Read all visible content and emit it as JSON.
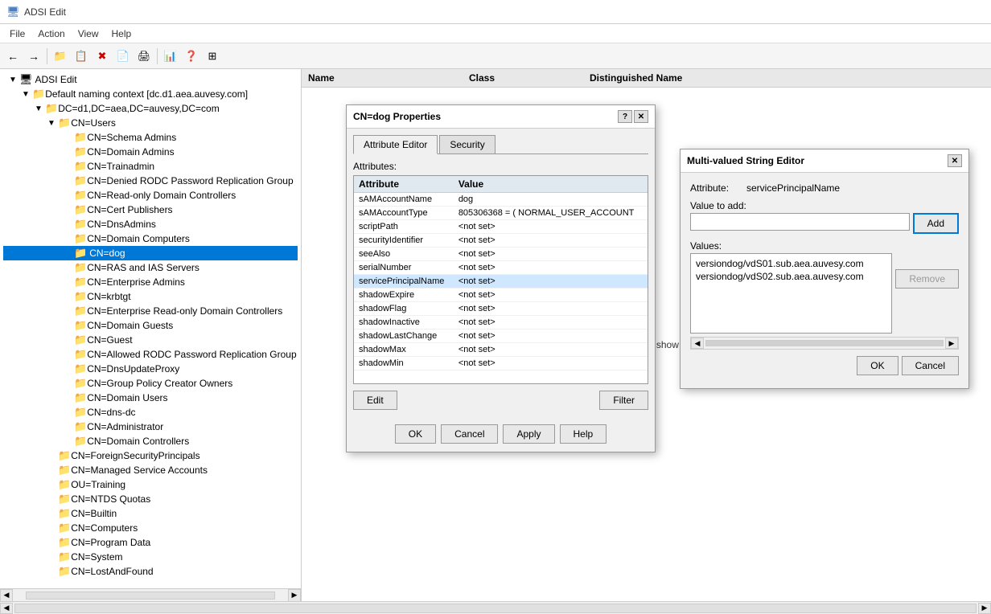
{
  "window": {
    "title": "ADSI Edit"
  },
  "menu": {
    "items": [
      "File",
      "Action",
      "View",
      "Help"
    ]
  },
  "toolbar": {
    "buttons": [
      "←",
      "→",
      "🗂",
      "📋",
      "✖",
      "📄",
      "🖨",
      "📊",
      "❓",
      "🔲"
    ]
  },
  "left_panel": {
    "header": "ADSI Edit",
    "tree": [
      {
        "label": "ADSI Edit",
        "level": 0,
        "expanded": true,
        "icon": "computer"
      },
      {
        "label": "Default naming context [dc.d1.aea.auvesy.com]",
        "level": 1,
        "expanded": true,
        "icon": "folder"
      },
      {
        "label": "DC=d1,DC=aea,DC=auvesy,DC=com",
        "level": 2,
        "expanded": true,
        "icon": "folder"
      },
      {
        "label": "CN=Users",
        "level": 3,
        "expanded": true,
        "icon": "folder"
      },
      {
        "label": "CN=Schema Admins",
        "level": 4,
        "icon": "folder"
      },
      {
        "label": "CN=Domain Admins",
        "level": 4,
        "icon": "folder"
      },
      {
        "label": "CN=Trainadmin",
        "level": 4,
        "icon": "folder"
      },
      {
        "label": "CN=Denied RODC Password Replication Group",
        "level": 4,
        "icon": "folder"
      },
      {
        "label": "CN=Read-only Domain Controllers",
        "level": 4,
        "icon": "folder"
      },
      {
        "label": "CN=Cert Publishers",
        "level": 4,
        "icon": "folder"
      },
      {
        "label": "CN=DnsAdmins",
        "level": 4,
        "icon": "folder"
      },
      {
        "label": "CN=Domain Computers",
        "level": 4,
        "icon": "folder"
      },
      {
        "label": "CN=dog",
        "level": 4,
        "icon": "folder",
        "selected": true
      },
      {
        "label": "CN=RAS and IAS Servers",
        "level": 4,
        "icon": "folder"
      },
      {
        "label": "CN=Enterprise Admins",
        "level": 4,
        "icon": "folder"
      },
      {
        "label": "CN=krbtgt",
        "level": 4,
        "icon": "folder"
      },
      {
        "label": "CN=Enterprise Read-only Domain Controllers",
        "level": 4,
        "icon": "folder"
      },
      {
        "label": "CN=Domain Guests",
        "level": 4,
        "icon": "folder"
      },
      {
        "label": "CN=Guest",
        "level": 4,
        "icon": "folder"
      },
      {
        "label": "CN=Allowed RODC Password Replication Group",
        "level": 4,
        "icon": "folder"
      },
      {
        "label": "CN=DnsUpdateProxy",
        "level": 4,
        "icon": "folder"
      },
      {
        "label": "CN=Group Policy Creator Owners",
        "level": 4,
        "icon": "folder"
      },
      {
        "label": "CN=Domain Users",
        "level": 4,
        "icon": "folder"
      },
      {
        "label": "CN=dns-dc",
        "level": 4,
        "icon": "folder"
      },
      {
        "label": "CN=Administrator",
        "level": 4,
        "icon": "folder"
      },
      {
        "label": "CN=Domain Controllers",
        "level": 4,
        "icon": "folder"
      },
      {
        "label": "CN=ForeignSecurityPrincipals",
        "level": 3,
        "icon": "folder"
      },
      {
        "label": "CN=Managed Service Accounts",
        "level": 3,
        "icon": "folder"
      },
      {
        "label": "OU=Training",
        "level": 3,
        "icon": "folder"
      },
      {
        "label": "CN=NTDS Quotas",
        "level": 3,
        "icon": "folder"
      },
      {
        "label": "CN=Builtin",
        "level": 3,
        "icon": "folder"
      },
      {
        "label": "CN=Computers",
        "level": 3,
        "icon": "folder"
      },
      {
        "label": "CN=Program Data",
        "level": 3,
        "icon": "folder"
      },
      {
        "label": "CN=System",
        "level": 3,
        "icon": "folder"
      },
      {
        "label": "CN=LostAndFound",
        "level": 3,
        "icon": "folder"
      }
    ]
  },
  "right_panel": {
    "columns": [
      "Name",
      "Class",
      "Distinguished Name"
    ],
    "empty_message": "There are no items to show in this view."
  },
  "properties_dialog": {
    "title": "CN=dog Properties",
    "tabs": [
      "Attribute Editor",
      "Security"
    ],
    "active_tab": "Attribute Editor",
    "attributes_label": "Attributes:",
    "columns": [
      "Attribute",
      "Value"
    ],
    "rows": [
      {
        "attr": "sAMAccountName",
        "value": "dog"
      },
      {
        "attr": "sAMAccountType",
        "value": "805306368 = ( NORMAL_USER_ACCOUNT"
      },
      {
        "attr": "scriptPath",
        "value": "<not set>"
      },
      {
        "attr": "securityIdentifier",
        "value": "<not set>"
      },
      {
        "attr": "seeAlso",
        "value": "<not set>"
      },
      {
        "attr": "serialNumber",
        "value": "<not set>"
      },
      {
        "attr": "servicePrincipalName",
        "value": "<not set>",
        "highlighted": true
      },
      {
        "attr": "shadowExpire",
        "value": "<not set>"
      },
      {
        "attr": "shadowFlag",
        "value": "<not set>"
      },
      {
        "attr": "shadowInactive",
        "value": "<not set>"
      },
      {
        "attr": "shadowLastChange",
        "value": "<not set>"
      },
      {
        "attr": "shadowMax",
        "value": "<not set>"
      },
      {
        "attr": "shadowMin",
        "value": "<not set>"
      }
    ],
    "edit_btn": "Edit",
    "filter_btn": "Filter",
    "ok_btn": "OK",
    "cancel_btn": "Cancel",
    "apply_btn": "Apply",
    "help_btn": "Help"
  },
  "multi_editor": {
    "title": "Multi-valued String Editor",
    "attribute_label": "Attribute:",
    "attribute_value": "servicePrincipalName",
    "value_to_add_label": "Value to add:",
    "add_btn": "Add",
    "values_label": "Values:",
    "values": [
      "versiondog/vdS01.sub.aea.auvesy.com",
      "versiondog/vdS02.sub.aea.auvesy.com"
    ],
    "remove_btn": "Remove",
    "ok_btn": "OK",
    "cancel_btn": "Cancel"
  }
}
